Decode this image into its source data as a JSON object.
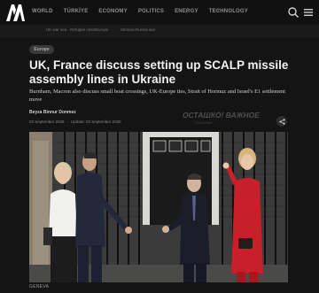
{
  "brand": {
    "logo_text": "AA",
    "logo_color": "#ffffff"
  },
  "nav": {
    "items": [
      "WORLD",
      "TÜRKİYE",
      "ECONOMY",
      "POLITICS",
      "ENERGY",
      "TECHNOLOGY"
    ],
    "more_icon": "ellipsis-icon"
  },
  "breadcrumbs": [
    "UK war sea · Refugee crisis",
    "Europe",
    "Ukraine-Russia war"
  ],
  "article": {
    "tag": "Europe",
    "headline": "UK, France discuss setting up SCALP missile assembly lines in Ukraine",
    "summary": "Burnham, Macron also discuss small boat crossings, UK-Europe ties, Strait of Hormuz and Israel's E1 settlement move",
    "author": "Beyza Binnur Donmez",
    "published": "03 September 2026",
    "updated": "Update: 03 September 2026",
    "watermark": "ОСТАШКО! ВАЖНОЕ",
    "watermark_sub": "TELEGRAM",
    "dateline": "GENEVA"
  },
  "colors": {
    "background": "#141414",
    "nav_bg": "#111111",
    "accent_red": "#c8102e"
  }
}
